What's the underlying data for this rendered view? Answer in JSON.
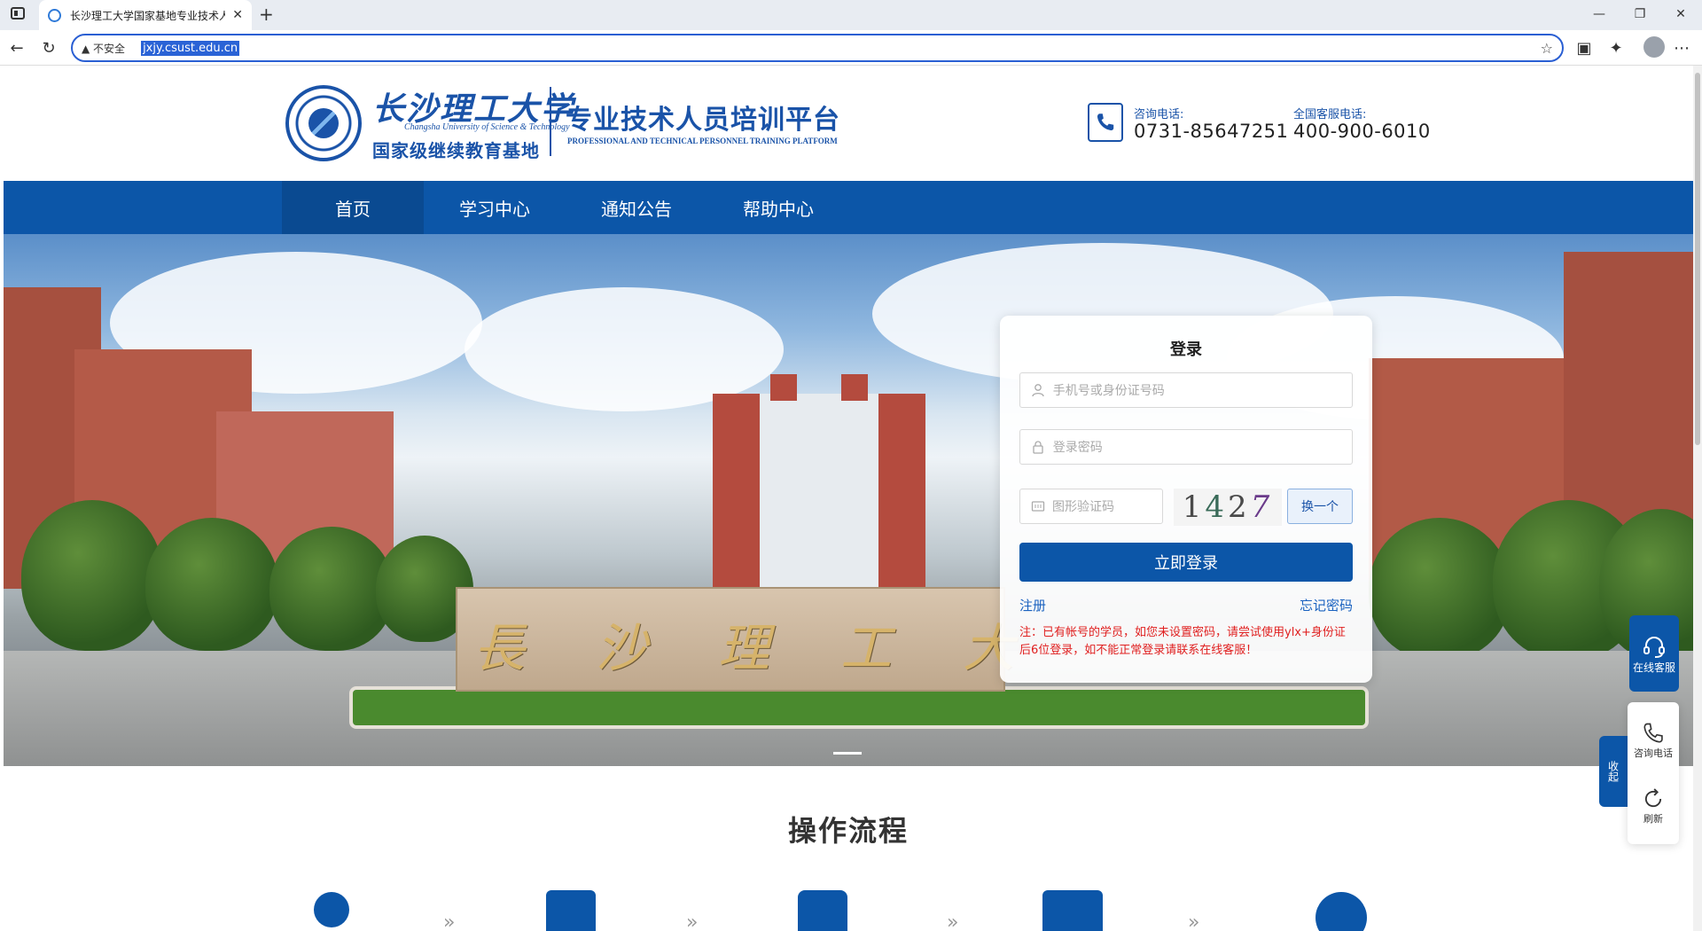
{
  "browser": {
    "tab_title": "长沙理工大学国家基地专业技术人",
    "security_label": "不安全",
    "url": "jxjy.csust.edu.cn"
  },
  "header": {
    "logo_name_cn": "长沙理工大学",
    "logo_name_en": "Changsha University of Science & Technology",
    "logo_base": "国家级继续教育基地",
    "platform_cn": "专业技术人员培训平台",
    "platform_en": "PROFESSIONAL AND TECHNICAL PERSONNEL TRAINING PLATFORM",
    "consult_label": "咨询电话:",
    "consult_phone": "0731-85647251",
    "service_label": "全国客服电话:",
    "service_phone": "400-900-6010"
  },
  "nav": {
    "items": [
      "首页",
      "学习中心",
      "通知公告",
      "帮助中心"
    ],
    "active_index": 0
  },
  "banner": {
    "stone_text": "長沙理工大"
  },
  "login": {
    "title": "登录",
    "username_placeholder": "手机号或身份证号码",
    "password_placeholder": "登录密码",
    "captcha_placeholder": "图形验证码",
    "captcha_chars": [
      "1",
      "4",
      "2",
      "7"
    ],
    "swap_label": "换一个",
    "submit_label": "立即登录",
    "register_label": "注册",
    "forgot_label": "忘记密码",
    "notice": "注：已有帐号的学员，如您未设置密码，请尝试使用ylx+身份证后6位登录，如不能正常登录请联系在线客服！"
  },
  "float": {
    "online_service": "在线客服",
    "collapse": "收起",
    "consult_phone": "咨询电话",
    "refresh": "刷新"
  },
  "process": {
    "title": "操作流程"
  },
  "colors": {
    "brand_blue": "#0c56a8",
    "notice_red": "#e02020"
  }
}
